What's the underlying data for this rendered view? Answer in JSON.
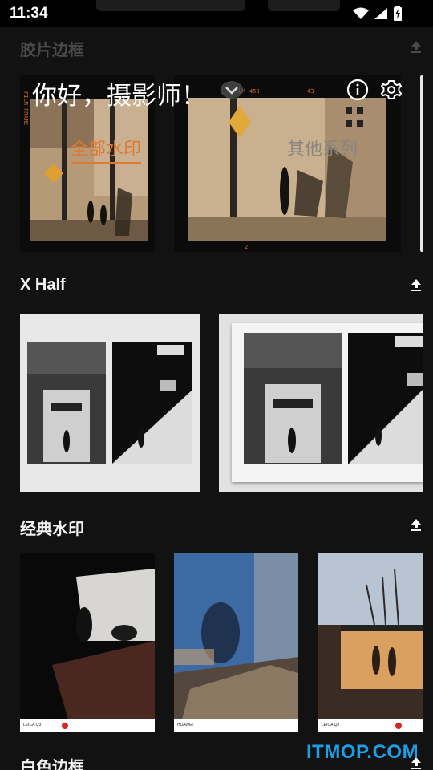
{
  "status_bar": {
    "time": "11:34",
    "icons": [
      "wifi-icon",
      "cellular-icon",
      "battery-charging-icon"
    ]
  },
  "header": {
    "greeting": "你好，摄影师！",
    "tabs": [
      {
        "label": "全部水印",
        "active": true
      },
      {
        "label": "其他系列",
        "active": false
      }
    ],
    "accent_color": "#e07a32"
  },
  "sections": [
    {
      "title": "胶片边框"
    },
    {
      "title": "X Half"
    },
    {
      "title": "经典水印"
    },
    {
      "title": "白色边框"
    }
  ],
  "film_frames": {
    "left_text": "FILM FRAME",
    "right_top": "FILM",
    "right_num1": "450",
    "right_num2": "43",
    "right_bottom": "2"
  },
  "classic_cards": [
    {
      "brand": "LEICA Q3"
    },
    {
      "brand": "HUAWEI"
    },
    {
      "brand": "LEICA Q3"
    }
  ],
  "footer_watermark": "ITMOP.COM"
}
